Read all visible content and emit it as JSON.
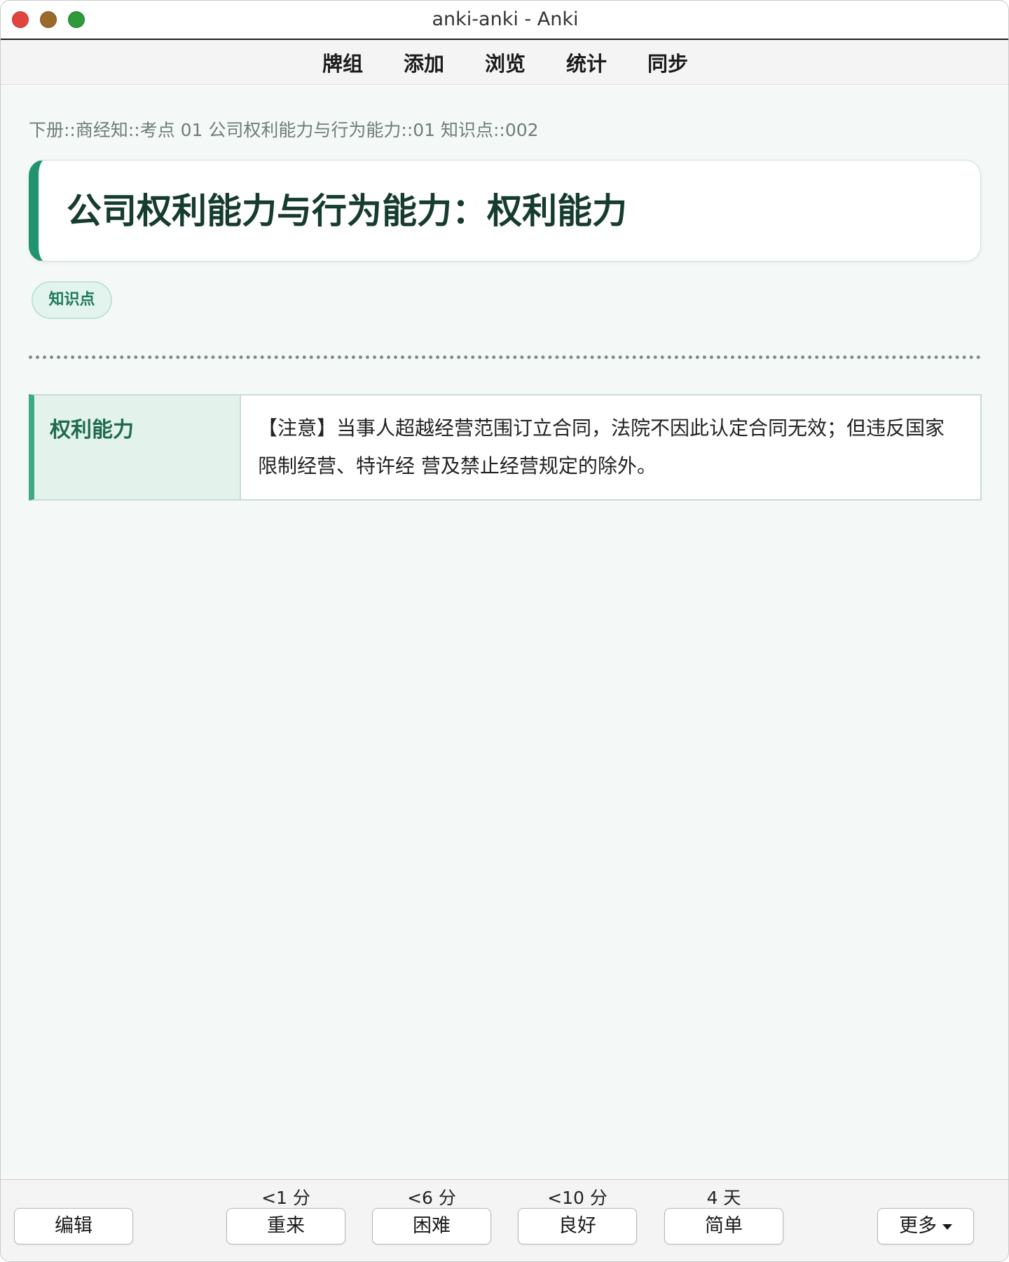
{
  "window": {
    "title": "anki-anki - Anki"
  },
  "menu": {
    "items": [
      "牌组",
      "添加",
      "浏览",
      "统计",
      "同步"
    ]
  },
  "card": {
    "deck_path": "下册::商经知::考点 01 公司权利能力与行为能力::01 知识点::002",
    "title": "公司权利能力与行为能力：权利能力",
    "tag": "知识点",
    "field_label": "权利能力",
    "field_value": "【注意】当事人超越经营范围订立合同，法院不因此认定合同无效；但违反国家限制经营、特许经 营及禁止经营规定的除外。"
  },
  "bottom": {
    "edit_label": "编辑",
    "more_label": "更多",
    "answers": [
      {
        "hint": "<1 分",
        "label": "重来"
      },
      {
        "hint": "<6 分",
        "label": "困难"
      },
      {
        "hint": "<10 分",
        "label": "良好"
      },
      {
        "hint": "4 天",
        "label": "简单"
      }
    ]
  },
  "colors": {
    "accent": "#1f946f",
    "tag_bg": "#e3f4ee",
    "label_bg": "#e3f3ec"
  },
  "icons": {
    "more": "chevron-down-icon"
  }
}
